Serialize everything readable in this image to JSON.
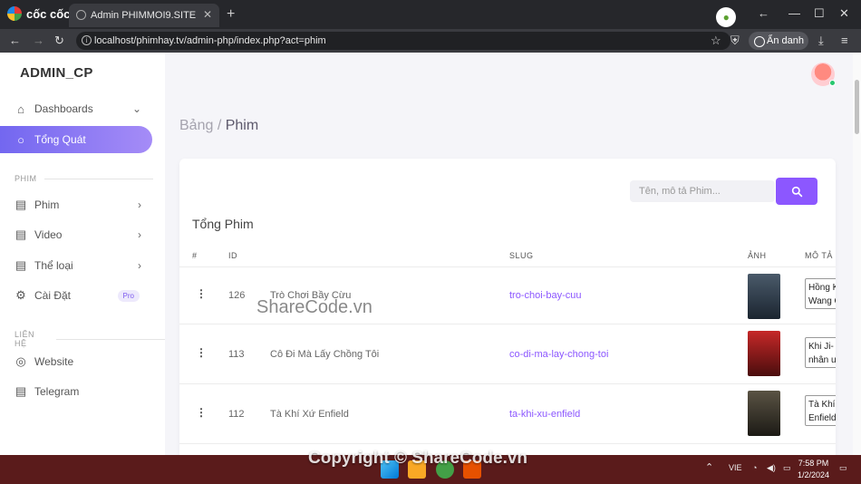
{
  "browser": {
    "brand": "cốc cốc",
    "tab_title": "Admin PHIMMOI9.SITE",
    "url": "localhost/phimhay.tv/admin-php/index.php?act=phim",
    "incognito_label": "Ẩn danh",
    "sharecode_logo": "SHARECODE.vn"
  },
  "sidebar": {
    "app_title": "ADMIN_CP",
    "items": [
      {
        "label": "Dashboards",
        "icon": "home-icon"
      },
      {
        "label": "Tổng Quát",
        "icon": "circle-icon"
      }
    ],
    "section_phim": "PHIM",
    "phim_items": [
      {
        "label": "Phim",
        "icon": "document-icon"
      },
      {
        "label": "Video",
        "icon": "document-icon"
      },
      {
        "label": "Thể loại",
        "icon": "document-icon"
      },
      {
        "label": "Cài Đặt",
        "icon": "gear-icon",
        "badge": "Pro"
      }
    ],
    "section_contact": "LIÊN HỆ",
    "contact_items": [
      {
        "label": "Website",
        "icon": "lifebuoy-icon"
      },
      {
        "label": "Telegram",
        "icon": "document-icon"
      }
    ]
  },
  "breadcrumb": {
    "parent": "Bảng /",
    "current": "Phim"
  },
  "card": {
    "search_placeholder": "Tên, mô tả Phim...",
    "title": "Tổng Phim",
    "columns": [
      "#",
      "ID",
      "SLUG",
      "ẢNH",
      "MÔ TẢ"
    ],
    "rows": [
      {
        "id": "126",
        "name": "Trò Chơi Bầy Cừu",
        "slug": "tro-choi-bay-cuu",
        "desc": "Hồng K\nWang C",
        "poster_color": "#2c3e50"
      },
      {
        "id": "113",
        "name": "Cô Đi Mà Lấy Chồng Tôi",
        "slug": "co-di-ma-lay-chong-toi",
        "desc": "Khi Ji-\nnhân u",
        "poster_color": "#b71c1c"
      },
      {
        "id": "112",
        "name": "Tà Khí Xứ Enfield",
        "slug": "ta-khi-xu-enfield",
        "desc": "Tà Khí\nEnfield",
        "poster_color": "#3e3a2f"
      }
    ]
  },
  "taskbar": {
    "lang": "VIE",
    "time": "7:58 PM",
    "date": "1/2/2024"
  },
  "watermark": {
    "bottom": "Copyright © ShareCode.vn",
    "middle": "ShareCode.vn"
  },
  "colors": {
    "accent": "#8c57ff",
    "taskbar": "#5a1b1b"
  }
}
